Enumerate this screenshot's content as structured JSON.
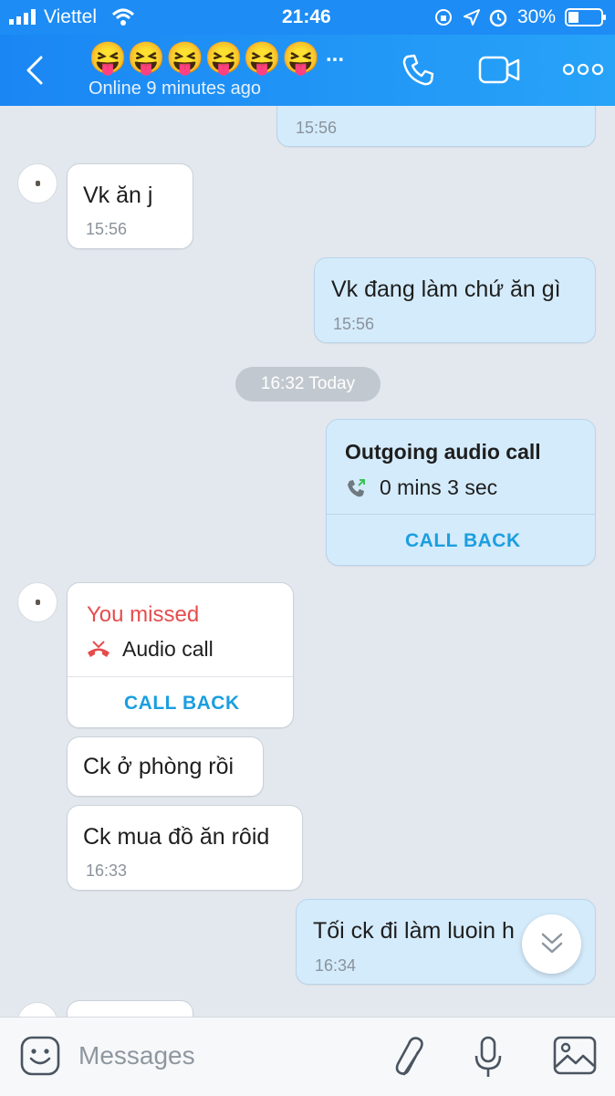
{
  "status": {
    "carrier": "Viettel",
    "time": "21:46",
    "battery": "30%"
  },
  "header": {
    "contact_name": "😝😝😝😝😝😝",
    "ellipsis": "...",
    "presence": "Online 9 minutes ago",
    "icons": [
      "back-arrow-icon",
      "phone-icon",
      "video-camera-icon",
      "more-options-icon"
    ]
  },
  "messages": {
    "m0_time": "15:56",
    "m1_text": "Vk ăn j",
    "m1_time": "15:56",
    "m2_text": "Vk đang làm chứ ăn gì",
    "m2_time": "15:56",
    "date_chip": "16:32 Today",
    "outgoing_call": {
      "title": "Outgoing audio call",
      "duration": "0 mins 3 sec",
      "action": "CALL BACK"
    },
    "missed_call": {
      "title": "You missed",
      "subtitle": "Audio call",
      "action": "CALL BACK"
    },
    "m5_text": "Ck ở phòng rồi",
    "m6_text": "Ck mua đồ ăn rôid",
    "m6_time": "16:33",
    "m7_text": "Tối ck đi làm luoin h",
    "m7_time": "16:34"
  },
  "composer": {
    "placeholder": "Messages",
    "icons": [
      "sticker-icon",
      "paperclip-icon",
      "microphone-icon",
      "image-icon"
    ]
  },
  "colors": {
    "header": "#1d8cf5",
    "missed": "#e74c4c",
    "action": "#1a9ee0",
    "outgoing_bubble": "#d4ebfb"
  }
}
